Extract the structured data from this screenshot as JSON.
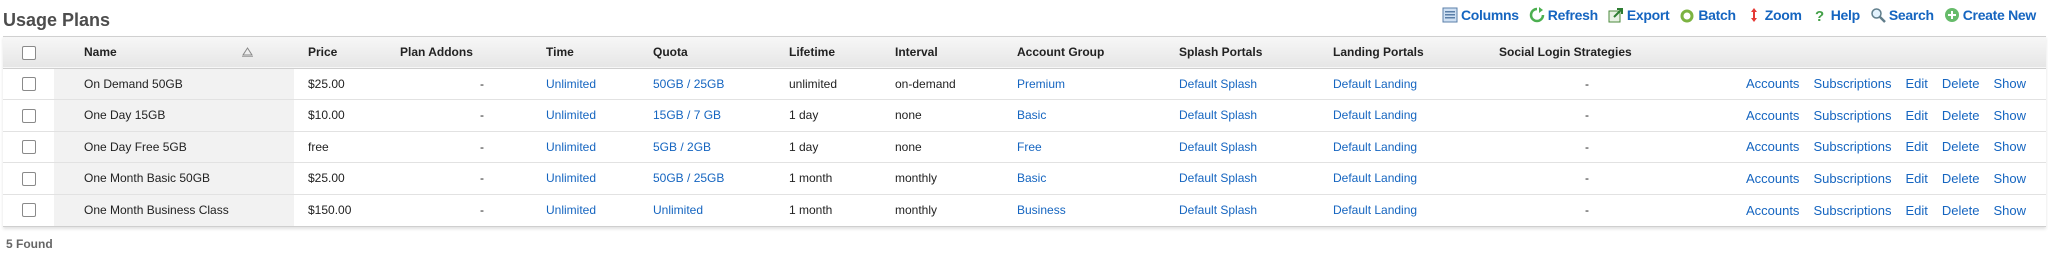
{
  "page": {
    "title": "Usage Plans",
    "found": "5 Found"
  },
  "toolbar": [
    {
      "label": "Columns",
      "icon": "columns-icon"
    },
    {
      "label": "Refresh",
      "icon": "refresh-icon"
    },
    {
      "label": "Export",
      "icon": "export-icon"
    },
    {
      "label": "Batch",
      "icon": "batch-icon"
    },
    {
      "label": "Zoom",
      "icon": "zoom-icon"
    },
    {
      "label": "Help",
      "icon": "help-icon"
    },
    {
      "label": "Search",
      "icon": "search-icon"
    },
    {
      "label": "Create New",
      "icon": "create-new-icon"
    }
  ],
  "columns": {
    "name": "Name",
    "price": "Price",
    "addons": "Plan Addons",
    "time": "Time",
    "quota": "Quota",
    "lifetime": "Lifetime",
    "interval": "Interval",
    "account_group": "Account Group",
    "splash": "Splash Portals",
    "landing": "Landing Portals",
    "social": "Social Login Strategies"
  },
  "actions": [
    "Accounts",
    "Subscriptions",
    "Edit",
    "Delete",
    "Show"
  ],
  "rows": [
    {
      "name": "On Demand 50GB",
      "price": "$25.00",
      "addons": "-",
      "time": "Unlimited",
      "quota": "50GB / 25GB",
      "lifetime": "unlimited",
      "interval": "on-demand",
      "account_group": "Premium",
      "splash": "Default Splash",
      "landing": "Default Landing",
      "social": "-"
    },
    {
      "name": "One Day 15GB",
      "price": "$10.00",
      "addons": "-",
      "time": "Unlimited",
      "quota": "15GB / 7 GB",
      "lifetime": "1 day",
      "interval": "none",
      "account_group": "Basic",
      "splash": "Default Splash",
      "landing": "Default Landing",
      "social": "-"
    },
    {
      "name": "One Day Free 5GB",
      "price": "free",
      "addons": "-",
      "time": "Unlimited",
      "quota": "5GB / 2GB",
      "lifetime": "1 day",
      "interval": "none",
      "account_group": "Free",
      "splash": "Default Splash",
      "landing": "Default Landing",
      "social": "-"
    },
    {
      "name": "One Month Basic 50GB",
      "price": "$25.00",
      "addons": "-",
      "time": "Unlimited",
      "quota": "50GB / 25GB",
      "lifetime": "1 month",
      "interval": "monthly",
      "account_group": "Basic",
      "splash": "Default Splash",
      "landing": "Default Landing",
      "social": "-"
    },
    {
      "name": "One Month Business Class",
      "price": "$150.00",
      "addons": "-",
      "time": "Unlimited",
      "quota": "Unlimited",
      "lifetime": "1 month",
      "interval": "monthly",
      "account_group": "Business",
      "splash": "Default Splash",
      "landing": "Default Landing",
      "social": "-"
    }
  ],
  "colors": {
    "link": "#1565c0",
    "header_bg": "#ececec",
    "name_col_bg": "#f2f2f2"
  }
}
